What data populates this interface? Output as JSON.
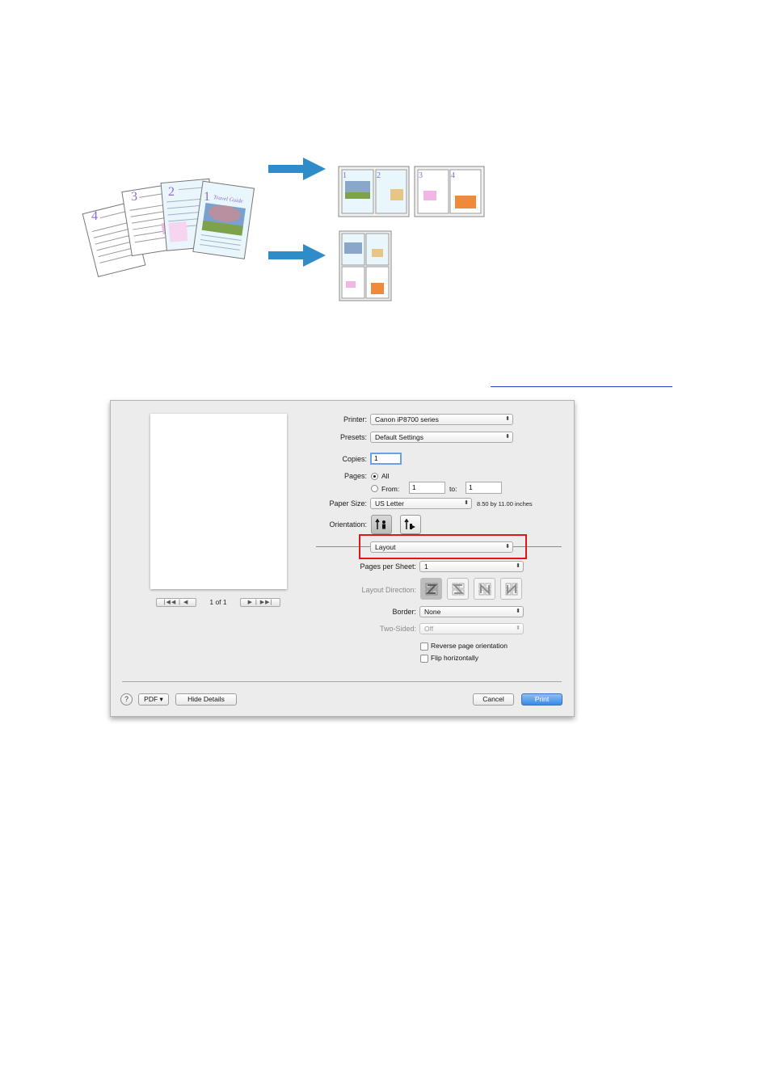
{
  "illustration": {
    "pages": [
      "4",
      "3",
      "2",
      "1"
    ],
    "page1_title": "Travel Guide"
  },
  "dialog": {
    "preview": {
      "page_count": "1 of 1"
    },
    "printer": {
      "label": "Printer:",
      "value": "Canon iP8700 series"
    },
    "presets": {
      "label": "Presets:",
      "value": "Default Settings"
    },
    "copies": {
      "label": "Copies:",
      "value": "1"
    },
    "pages": {
      "label": "Pages:",
      "all_label": "All",
      "from_label": "From:",
      "from_value": "1",
      "to_label": "to:",
      "to_value": "1",
      "selected": "All"
    },
    "paper_size": {
      "label": "Paper Size:",
      "value": "US Letter",
      "dimensions": "8.50 by 11.00 inches"
    },
    "orientation": {
      "label": "Orientation:",
      "selected": "portrait"
    },
    "section": {
      "value": "Layout"
    },
    "pages_per_sheet": {
      "label": "Pages per Sheet:",
      "value": "1"
    },
    "layout_direction": {
      "label": "Layout Direction:",
      "selected": 0
    },
    "border": {
      "label": "Border:",
      "value": "None"
    },
    "two_sided": {
      "label": "Two-Sided:",
      "value": "Off"
    },
    "reverse_orientation": {
      "label": "Reverse page orientation",
      "checked": false
    },
    "flip_horizontally": {
      "label": "Flip horizontally",
      "checked": false
    },
    "footer": {
      "help": "?",
      "pdf": "PDF ▾",
      "hide_details": "Hide Details",
      "cancel": "Cancel",
      "print": "Print"
    }
  },
  "colors": {
    "arrow": "#2e8cc9",
    "highlight": "#e0161b",
    "default_button": "#3a8ae6"
  }
}
